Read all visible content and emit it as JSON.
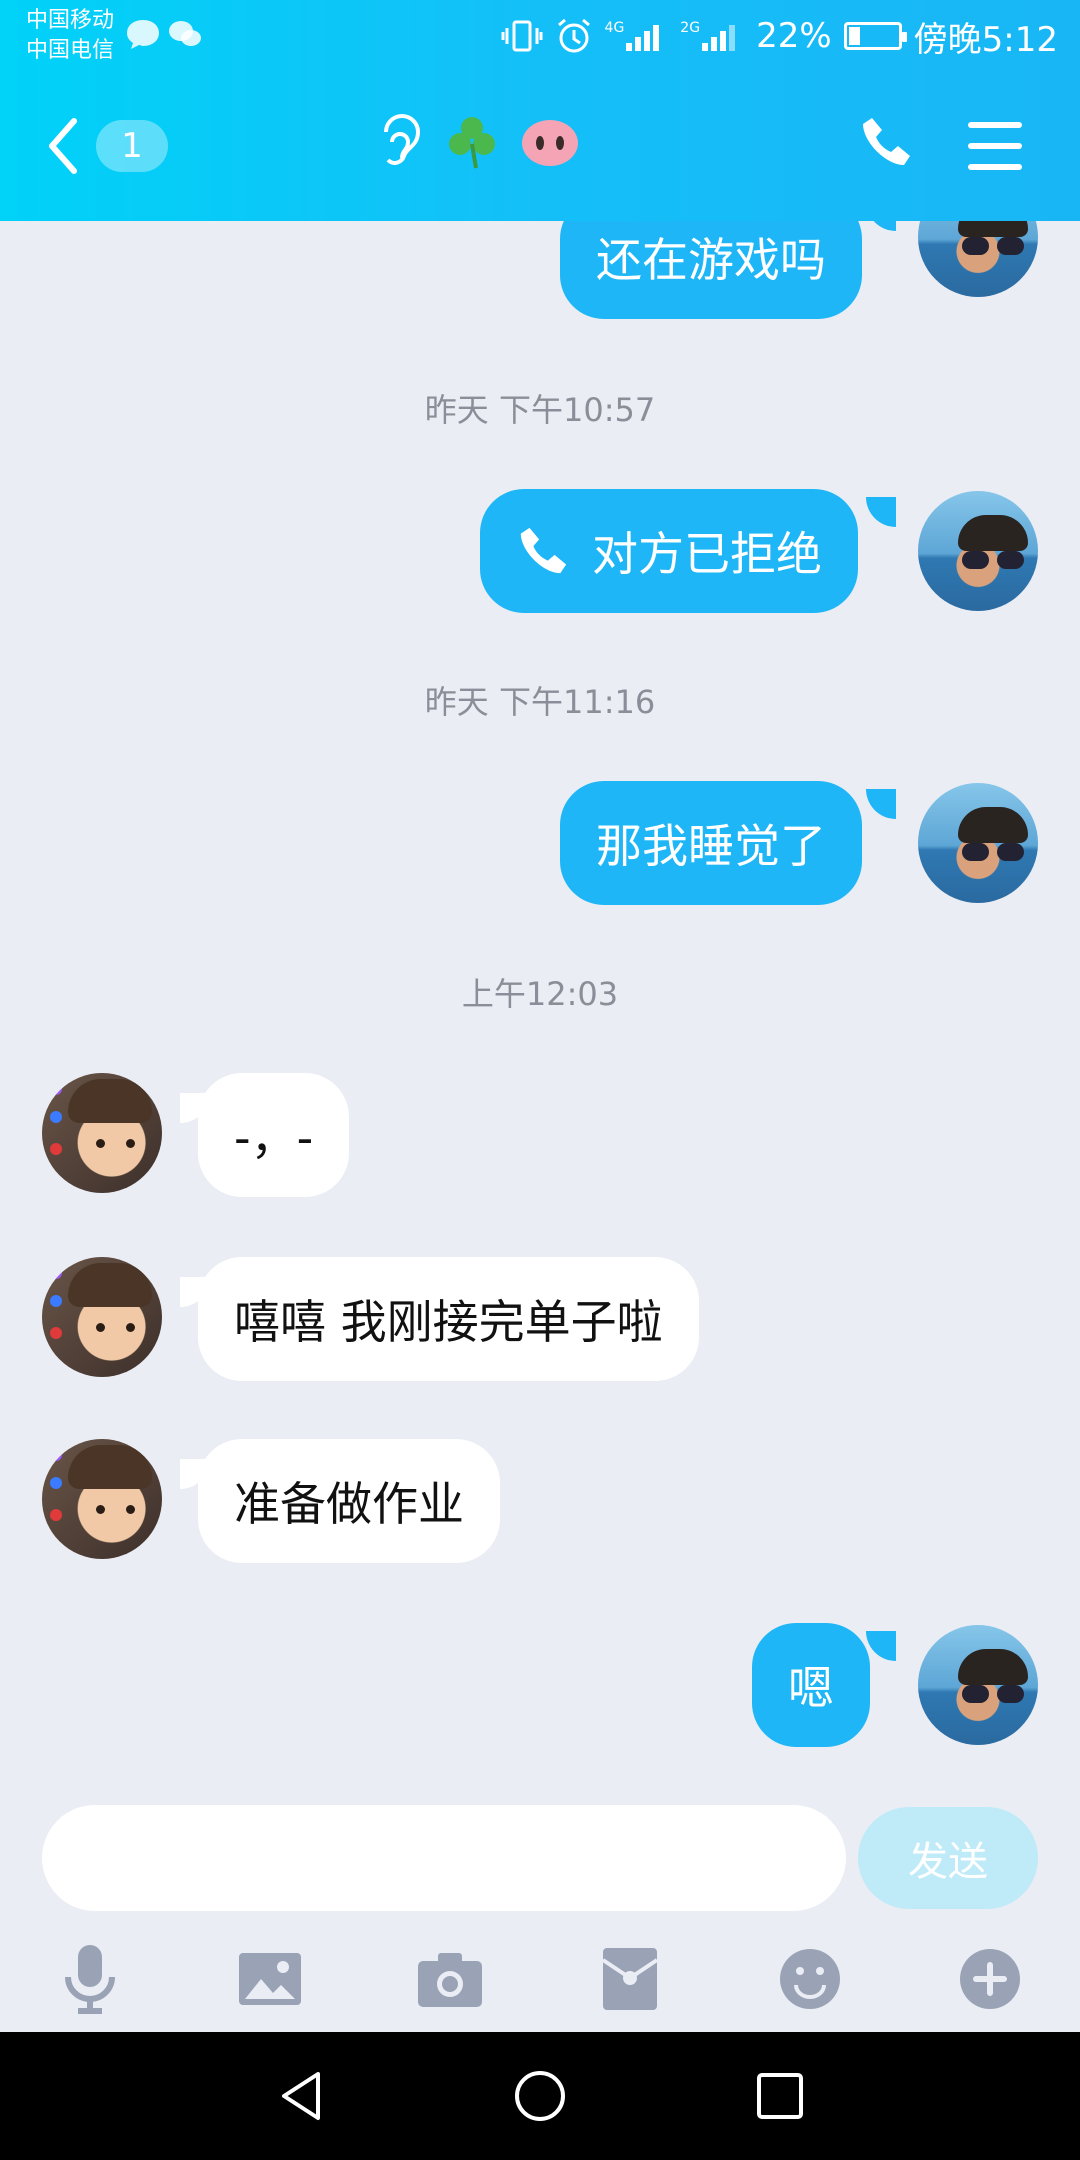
{
  "status_bar": {
    "carrier_1": "中国移动",
    "carrier_2": "中国电信",
    "network_1": "4G",
    "network_2": "2G",
    "battery_percent": "22%",
    "battery_level": 0.22,
    "time": "傍晚5:12"
  },
  "navbar": {
    "unread_count": "1",
    "title_icons": [
      "ear-icon",
      "clover-icon",
      "pig-nose-icon"
    ]
  },
  "messages": [
    {
      "side": "me",
      "text": "还在游戏吗"
    },
    {
      "timestamp": "昨天 下午10:57"
    },
    {
      "side": "me",
      "text": "对方已拒绝",
      "icon": "phone-icon"
    },
    {
      "timestamp": "昨天 下午11:16"
    },
    {
      "side": "me",
      "text": "那我睡觉了"
    },
    {
      "timestamp": "上午12:03"
    },
    {
      "side": "her",
      "text": "-，-"
    },
    {
      "side": "her",
      "text": "嘻嘻 我刚接完单子啦"
    },
    {
      "side": "her",
      "text": "准备做作业"
    },
    {
      "side": "me",
      "text": "嗯"
    }
  ],
  "input": {
    "value": "",
    "placeholder": "",
    "send_label": "发送"
  },
  "toolbar": [
    "mic-icon",
    "image-icon",
    "camera-icon",
    "red-packet-icon",
    "emoji-icon",
    "plus-icon"
  ],
  "colors": {
    "header_gradient_start": "#00d2f8",
    "header_gradient_end": "#19b6f5",
    "bubble_me": "#1eb6f6",
    "bubble_her": "#ffffff",
    "background": "#eaedf4",
    "send_button_disabled": "#bfeaf8"
  }
}
